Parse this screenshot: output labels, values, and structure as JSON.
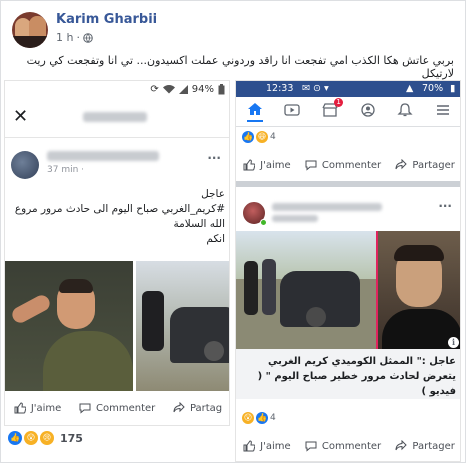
{
  "post": {
    "author": "Karim Gharbii",
    "time": "1 h",
    "text": "بربي عاتش هكا الكذب امي تفجعت انا راقد وردوني عملت اكسيدون... تي انا وتفجعت كي ريت لارتيكل"
  },
  "left_screenshot": {
    "battery": "94%",
    "close_label": "✕",
    "post_time": "37 min ·",
    "text_lines": [
      "عاجل",
      "#كريم_الغربي صباح اليوم الى حادث مرور مروع",
      "الله السلامة",
      "انكم"
    ],
    "actions": {
      "like": "J'aime",
      "comment": "Commenter",
      "share": "Partag"
    }
  },
  "right_screenshot": {
    "status_time": "12:33",
    "battery": "70%",
    "nav_badge": "1",
    "top_reaction_count": "4",
    "actions": {
      "like": "J'aime",
      "comment": "Commenter",
      "share": "Partager"
    },
    "caption": "عاجل :\" الممثل الكوميدي كريم الغربي يتعرض لحادث مرور خطير صباح اليوم \" ( فيديو )",
    "bottom_reaction_count": "4"
  },
  "reactions": {
    "count": "175"
  },
  "colors": {
    "brand": "#385898",
    "fb_blue": "#1877f2",
    "status_bar": "#2d4f8e"
  }
}
